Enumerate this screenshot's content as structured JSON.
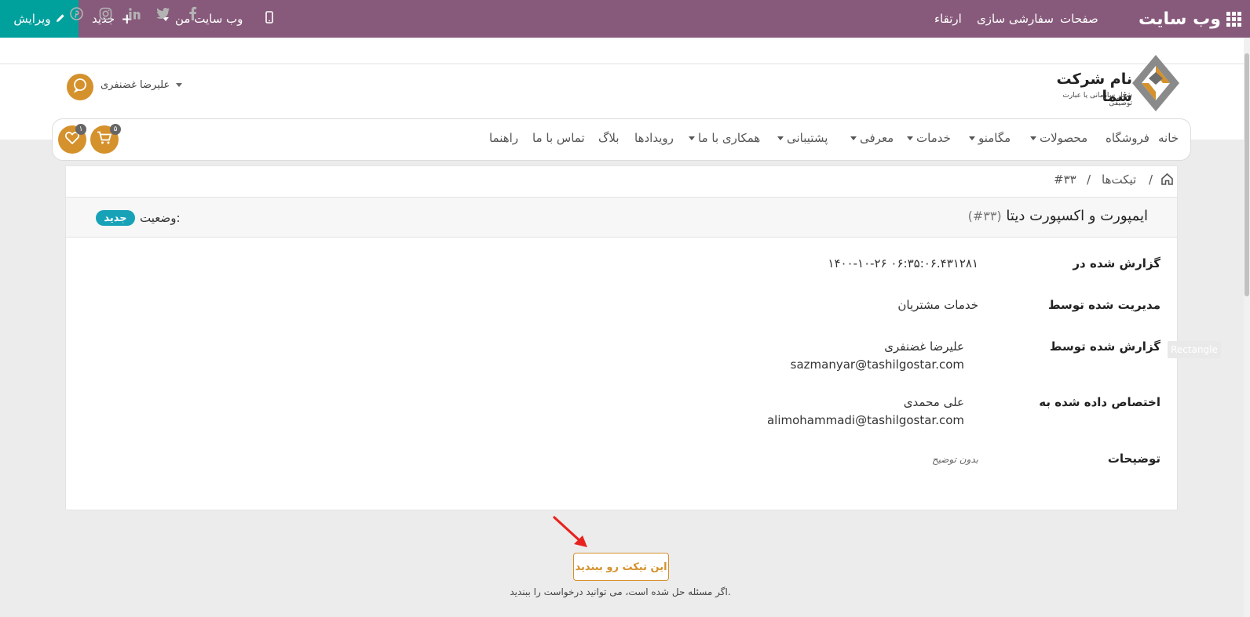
{
  "topbar": {
    "brand": "وب سایت",
    "menu": [
      "صفحات",
      "سفارشی سازی",
      "ارتقاء"
    ],
    "my_website": "وب سایت من",
    "new": "جدید",
    "edit": "ویرایش"
  },
  "social": [
    "facebook-icon",
    "twitter-icon",
    "linkedin-icon",
    "instagram-icon",
    "pinterest-icon"
  ],
  "logo": {
    "name": "نام شرکت شما",
    "tagline": "شعار سازمانی یا عبارت توصیفی"
  },
  "user": {
    "name": "علیرضا غضنفری"
  },
  "nav": {
    "items": [
      {
        "label": "خانه",
        "dropdown": false
      },
      {
        "label": "فروشگاه",
        "dropdown": false
      },
      {
        "label": "محصولات",
        "dropdown": true
      },
      {
        "label": "مگامنو",
        "dropdown": true
      },
      {
        "label": "خدمات",
        "dropdown": true
      },
      {
        "label": "معرفی",
        "dropdown": true
      },
      {
        "label": "پشتیبانی",
        "dropdown": true
      },
      {
        "label": "همکاری با ما",
        "dropdown": true
      },
      {
        "label": "رویدادها",
        "dropdown": false
      },
      {
        "label": "بلاگ",
        "dropdown": false
      },
      {
        "label": "تماس با ما",
        "dropdown": false
      },
      {
        "label": "راهنما",
        "dropdown": false
      }
    ],
    "cart_count": "۵",
    "wishlist_count": "۱"
  },
  "breadcrumb": {
    "sep1": "/",
    "tickets": "تیکت‌ها",
    "sep2": "/",
    "current": "#۳۳"
  },
  "ticket": {
    "title": "ایمپورت و اکسپورت دیتا",
    "number": "(#۳۳)",
    "status_label": "وضعیت:",
    "status": "جدید",
    "fields": {
      "reported_on_label": "گزارش شده در",
      "reported_on": "۱۴۰۰-۱۰-۲۶ ۰۶:۳۵:۰۶.۴۳۱۲۸۱",
      "managed_by_label": "مدیریت شده توسط",
      "managed_by": "خدمات مشتریان",
      "reported_by_label": "گزارش شده توسط",
      "reported_by_name": "علیرضا غضنفری",
      "reported_by_email": "sazmanyar@tashilgostar.com",
      "assigned_to_label": "اختصاص داده شده به",
      "assigned_to_name": "علی محمدی",
      "assigned_to_email": "alimohammadi@tashilgostar.com",
      "description_label": "توضیحات",
      "description": "بدون توضیح"
    }
  },
  "overlay_tag": "Rectangle",
  "actions": {
    "close_ticket": "این تیکت رو ببندید",
    "help": "اگر مسئله حل شده است، می توانید درخواست را ببندید."
  },
  "colors": {
    "topbar": "#875a7b",
    "edit": "#00a09d",
    "accent": "#d4912c",
    "status": "#17a2b8",
    "arrow": "#e8231f"
  }
}
